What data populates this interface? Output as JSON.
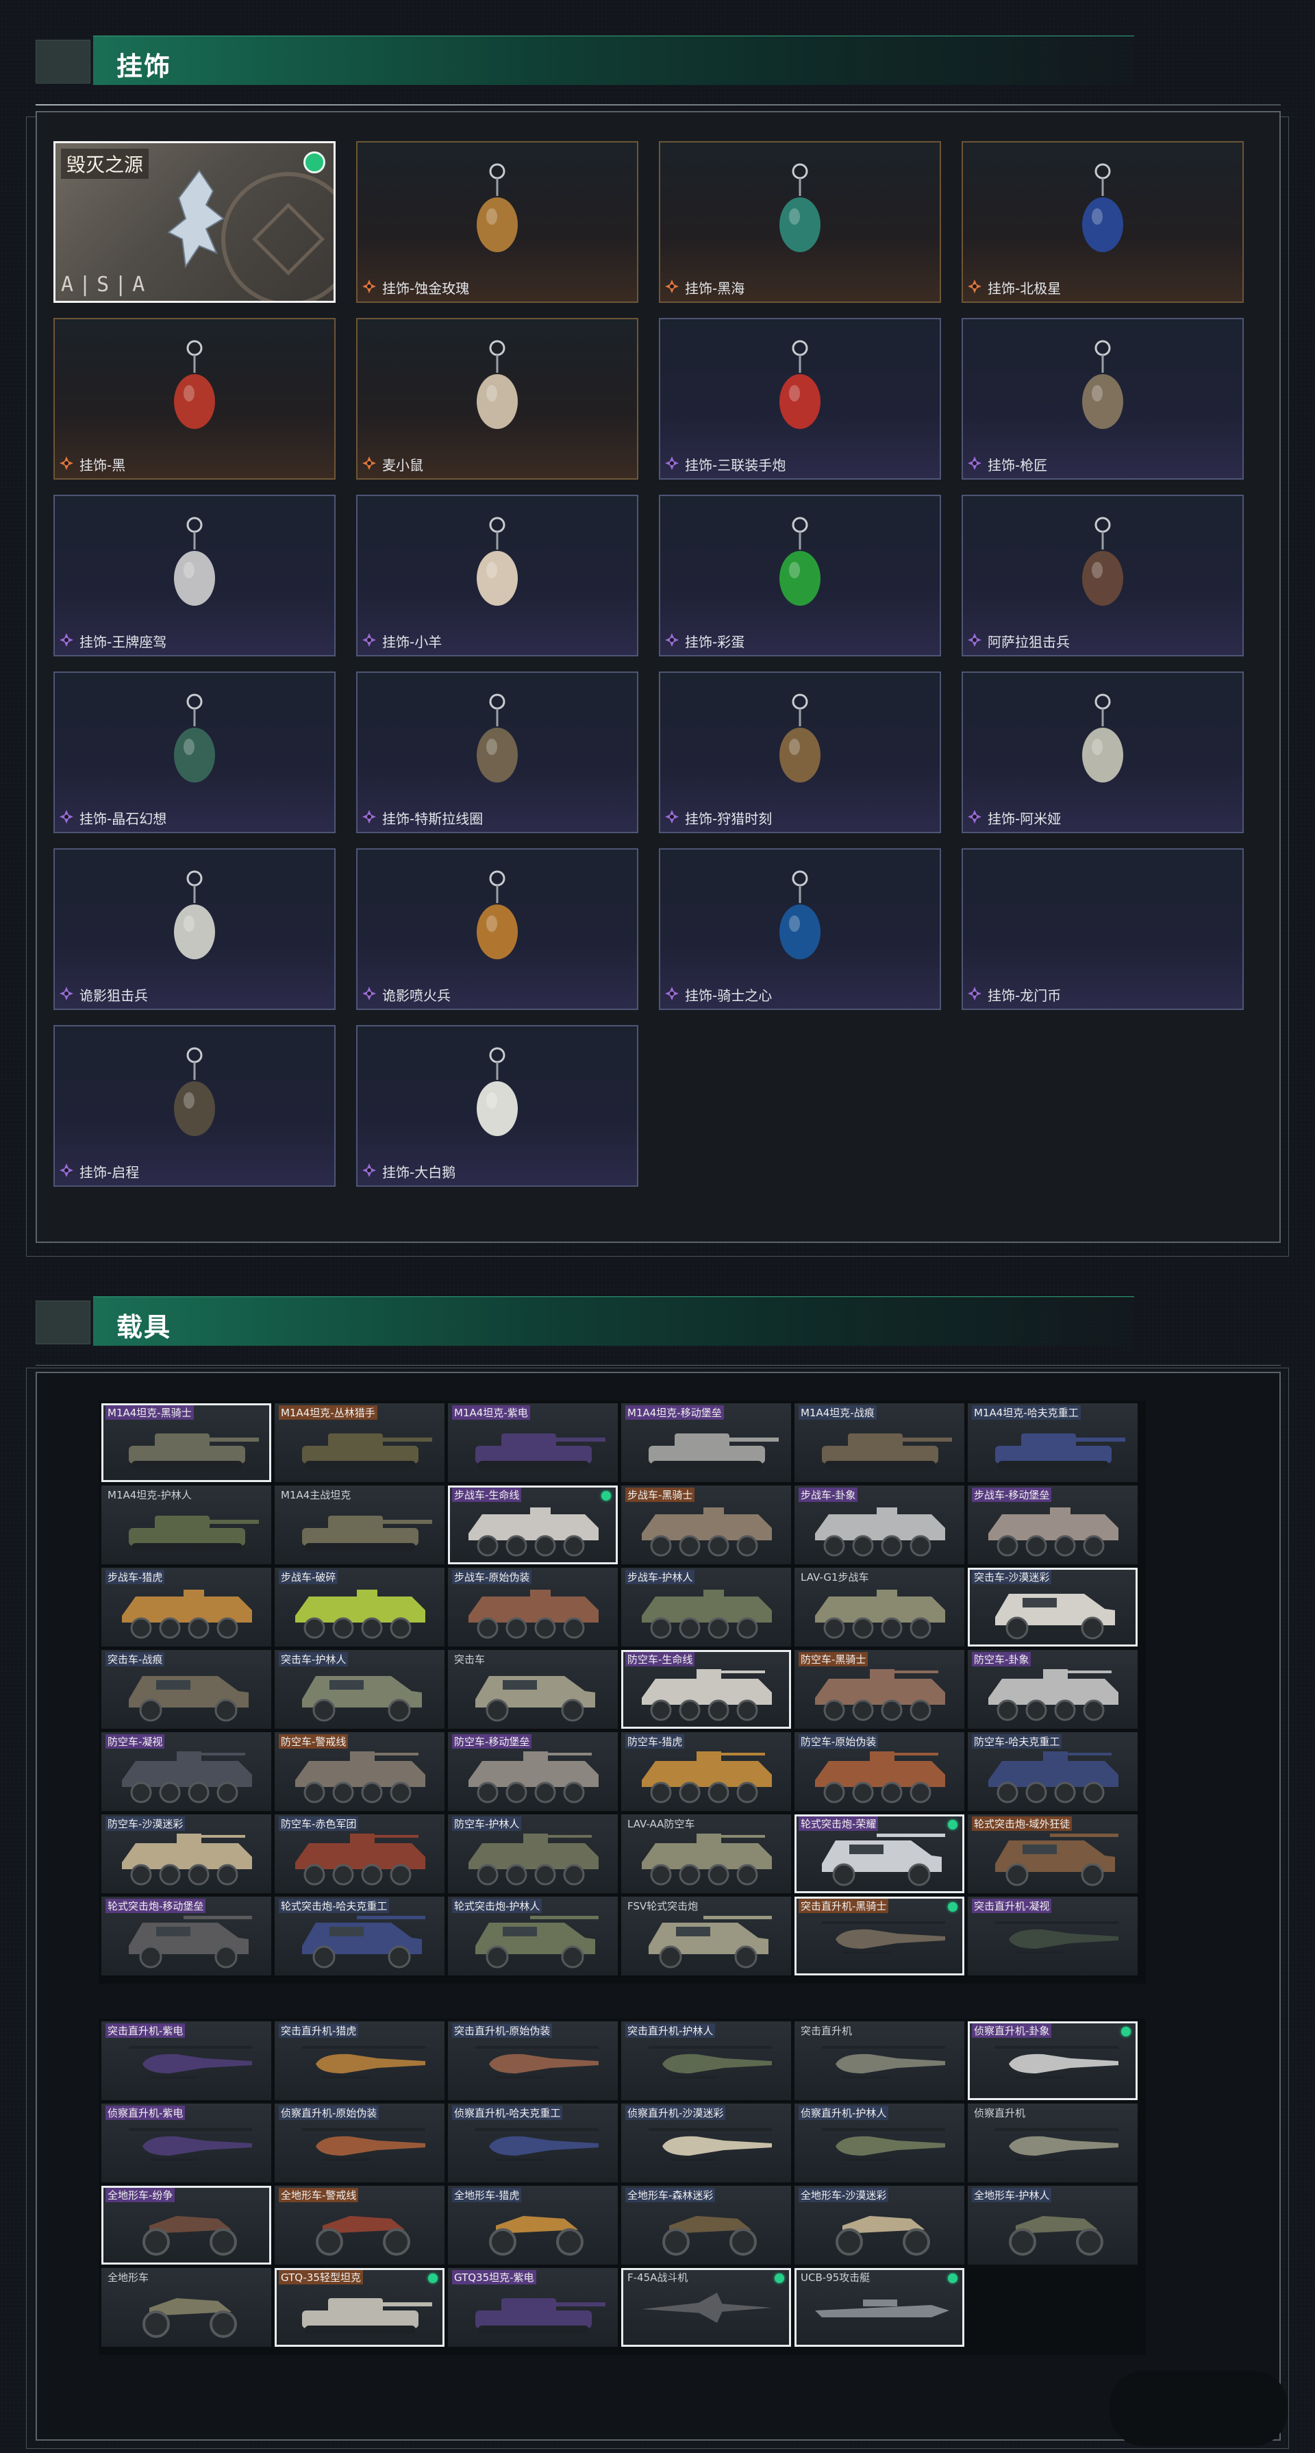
{
  "charms_section": {
    "title": "挂饰",
    "featured": {
      "title": "毁灭之源",
      "logo": "A|S|A"
    },
    "items": [
      {
        "name": "挂饰-蚀金玫瑰",
        "rarity": "orange"
      },
      {
        "name": "挂饰-黑海",
        "rarity": "orange"
      },
      {
        "name": "挂饰-北极星",
        "rarity": "orange"
      },
      {
        "name": "挂饰-黑",
        "rarity": "orange"
      },
      {
        "name": "麦小鼠",
        "rarity": "orange"
      },
      {
        "name": "挂饰-三联装手炮",
        "rarity": "purple"
      },
      {
        "name": "挂饰-枪匠",
        "rarity": "purple"
      },
      {
        "name": "挂饰-王牌座驾",
        "rarity": "purple"
      },
      {
        "name": "挂饰-小羊",
        "rarity": "purple"
      },
      {
        "name": "挂饰-彩蛋",
        "rarity": "purple"
      },
      {
        "name": "阿萨拉狙击兵",
        "rarity": "purple"
      },
      {
        "name": "挂饰-晶石幻想",
        "rarity": "purple"
      },
      {
        "name": "挂饰-特斯拉线圈",
        "rarity": "purple"
      },
      {
        "name": "挂饰-狩猎时刻",
        "rarity": "purple"
      },
      {
        "name": "挂饰-阿米娅",
        "rarity": "purple"
      },
      {
        "name": "诡影狙击兵",
        "rarity": "purple"
      },
      {
        "name": "诡影喷火兵",
        "rarity": "purple"
      },
      {
        "name": "挂饰-骑士之心",
        "rarity": "purple"
      },
      {
        "name": "挂饰-龙门币",
        "rarity": "purple"
      },
      {
        "name": "挂饰-启程",
        "rarity": "purple"
      },
      {
        "name": "挂饰-大白鹅",
        "rarity": "purple"
      }
    ]
  },
  "vehicles_section": {
    "title": "载具",
    "grid_a": [
      {
        "name": "M1A4坦克-黑骑士",
        "tag": "purple",
        "sel": true,
        "dot": false,
        "kind": "tank",
        "color": "#6a6a5a"
      },
      {
        "name": "M1A4坦克-丛林猎手",
        "tag": "orange",
        "sel": false,
        "dot": false,
        "kind": "tank",
        "color": "#5d5a40"
      },
      {
        "name": "M1A4坦克-紫电",
        "tag": "purple",
        "sel": false,
        "dot": false,
        "kind": "tank",
        "color": "#4a3c70"
      },
      {
        "name": "M1A4坦克-移动堡垒",
        "tag": "purple",
        "sel": false,
        "dot": false,
        "kind": "tank",
        "color": "#9a9b98"
      },
      {
        "name": "M1A4坦克-战痕",
        "tag": "blue",
        "sel": false,
        "dot": false,
        "kind": "tank",
        "color": "#6b5f4e"
      },
      {
        "name": "M1A4坦克-哈夫克重工",
        "tag": "blue",
        "sel": false,
        "dot": false,
        "kind": "tank",
        "color": "#3c4a80"
      },
      {
        "name": "M1A4坦克-护林人",
        "tag": "none",
        "sel": false,
        "dot": false,
        "kind": "tank",
        "color": "#5a6548"
      },
      {
        "name": "M1A4主战坦克",
        "tag": "none",
        "sel": false,
        "dot": false,
        "kind": "tank",
        "color": "#6d6a55"
      },
      {
        "name": "步战车-生命线",
        "tag": "purple",
        "sel": true,
        "dot": true,
        "kind": "apc",
        "color": "#c8c5c0"
      },
      {
        "name": "步战车-黑骑士",
        "tag": "orange",
        "sel": false,
        "dot": false,
        "kind": "apc",
        "color": "#8a7a6a"
      },
      {
        "name": "步战车-卦象",
        "tag": "purple",
        "sel": false,
        "dot": false,
        "kind": "apc",
        "color": "#b5b6b8"
      },
      {
        "name": "步战车-移动堡垒",
        "tag": "purple",
        "sel": false,
        "dot": false,
        "kind": "apc",
        "color": "#9a8f88"
      },
      {
        "name": "步战车-猎虎",
        "tag": "blue",
        "sel": false,
        "dot": false,
        "kind": "apc",
        "color": "#b5823d"
      },
      {
        "name": "步战车-破碎",
        "tag": "blue",
        "sel": false,
        "dot": false,
        "kind": "apc",
        "color": "#a8c040"
      },
      {
        "name": "步战车-原始伪装",
        "tag": "blue",
        "sel": false,
        "dot": false,
        "kind": "apc",
        "color": "#8a5c48"
      },
      {
        "name": "步战车-护林人",
        "tag": "blue",
        "sel": false,
        "dot": false,
        "kind": "apc",
        "color": "#6a7258"
      },
      {
        "name": "LAV-G1步战车",
        "tag": "none",
        "sel": false,
        "dot": false,
        "kind": "apc",
        "color": "#8a8a70"
      },
      {
        "name": "突击车-沙漠迷彩",
        "tag": "blue",
        "sel": true,
        "dot": false,
        "kind": "jeep",
        "color": "#d2d0c8"
      },
      {
        "name": "突击车-战痕",
        "tag": "blue",
        "sel": false,
        "dot": false,
        "kind": "jeep",
        "color": "#6e6656"
      },
      {
        "name": "突击车-护林人",
        "tag": "blue",
        "sel": false,
        "dot": false,
        "kind": "jeep",
        "color": "#7a806a"
      },
      {
        "name": "突击车",
        "tag": "none",
        "sel": false,
        "dot": false,
        "kind": "jeep",
        "color": "#9a9884"
      },
      {
        "name": "防空车-生命线",
        "tag": "purple",
        "sel": true,
        "dot": false,
        "kind": "aa",
        "color": "#c9c6c0"
      },
      {
        "name": "防空车-黑骑士",
        "tag": "orange",
        "sel": false,
        "dot": false,
        "kind": "aa",
        "color": "#8c6a5a"
      },
      {
        "name": "防空车-卦象",
        "tag": "purple",
        "sel": false,
        "dot": false,
        "kind": "aa",
        "color": "#b8b8b8"
      },
      {
        "name": "防空车-凝视",
        "tag": "purple",
        "sel": false,
        "dot": false,
        "kind": "aa",
        "color": "#4a4f5a"
      },
      {
        "name": "防空车-警戒线",
        "tag": "orange",
        "sel": false,
        "dot": false,
        "kind": "aa",
        "color": "#7a7268"
      },
      {
        "name": "防空车-移动堡垒",
        "tag": "purple",
        "sel": false,
        "dot": false,
        "kind": "aa",
        "color": "#8c8680"
      },
      {
        "name": "防空车-猎虎",
        "tag": "blue",
        "sel": false,
        "dot": false,
        "kind": "aa",
        "color": "#b6843a"
      },
      {
        "name": "防空车-原始伪装",
        "tag": "blue",
        "sel": false,
        "dot": false,
        "kind": "aa",
        "color": "#9a5a3a"
      },
      {
        "name": "防空车-哈夫克重工",
        "tag": "blue",
        "sel": false,
        "dot": false,
        "kind": "aa",
        "color": "#3a4878"
      },
      {
        "name": "防空车-沙漠迷彩",
        "tag": "blue",
        "sel": false,
        "dot": false,
        "kind": "aa",
        "color": "#b7a88a"
      },
      {
        "name": "防空车-赤色军团",
        "tag": "blue",
        "sel": false,
        "dot": false,
        "kind": "aa",
        "color": "#8a4030"
      },
      {
        "name": "防空车-护林人",
        "tag": "blue",
        "sel": false,
        "dot": false,
        "kind": "aa",
        "color": "#6a6e58"
      },
      {
        "name": "LAV-AA防空车",
        "tag": "none",
        "sel": false,
        "dot": false,
        "kind": "aa",
        "color": "#8a8a72"
      },
      {
        "name": "轮式突击炮-荣耀",
        "tag": "purple",
        "sel": true,
        "dot": true,
        "kind": "wheeled",
        "color": "#c9ccd0"
      },
      {
        "name": "轮式突击炮-域外狂徒",
        "tag": "orange",
        "sel": false,
        "dot": false,
        "kind": "wheeled",
        "color": "#7a5a40"
      },
      {
        "name": "轮式突击炮-移动堡垒",
        "tag": "purple",
        "sel": false,
        "dot": false,
        "kind": "wheeled",
        "color": "#5a5a5c"
      },
      {
        "name": "轮式突击炮-哈夫克重工",
        "tag": "blue",
        "sel": false,
        "dot": false,
        "kind": "wheeled",
        "color": "#3c4a80"
      },
      {
        "name": "轮式突击炮-护林人",
        "tag": "blue",
        "sel": false,
        "dot": false,
        "kind": "wheeled",
        "color": "#6a7258"
      },
      {
        "name": "FSV轮式突击炮",
        "tag": "none",
        "sel": false,
        "dot": false,
        "kind": "wheeled",
        "color": "#9a9882"
      },
      {
        "name": "突击直升机-黑骑士",
        "tag": "orange",
        "sel": true,
        "dot": true,
        "kind": "heli",
        "color": "#6e6458"
      },
      {
        "name": "突击直升机-凝视",
        "tag": "purple",
        "sel": false,
        "dot": false,
        "kind": "heli",
        "color": "#3e4a40"
      }
    ],
    "grid_b": [
      {
        "name": "突击直升机-紫电",
        "tag": "purple",
        "sel": false,
        "dot": false,
        "kind": "heli",
        "color": "#4a3c70"
      },
      {
        "name": "突击直升机-猎虎",
        "tag": "blue",
        "sel": false,
        "dot": false,
        "kind": "heli",
        "color": "#a8783a"
      },
      {
        "name": "突击直升机-原始伪装",
        "tag": "blue",
        "sel": false,
        "dot": false,
        "kind": "heli",
        "color": "#8a5c48"
      },
      {
        "name": "突击直升机-护林人",
        "tag": "blue",
        "sel": false,
        "dot": false,
        "kind": "heli",
        "color": "#5e6a50"
      },
      {
        "name": "突击直升机",
        "tag": "none",
        "sel": false,
        "dot": false,
        "kind": "heli",
        "color": "#7a7c70"
      },
      {
        "name": "侦察直升机-卦象",
        "tag": "purple",
        "sel": true,
        "dot": true,
        "kind": "scout",
        "color": "#c0c0c0"
      },
      {
        "name": "侦察直升机-紫电",
        "tag": "purple",
        "sel": false,
        "dot": false,
        "kind": "scout",
        "color": "#4a3c70"
      },
      {
        "name": "侦察直升机-原始伪装",
        "tag": "blue",
        "sel": false,
        "dot": false,
        "kind": "scout",
        "color": "#9a5a3a"
      },
      {
        "name": "侦察直升机-哈夫克重工",
        "tag": "blue",
        "sel": false,
        "dot": false,
        "kind": "scout",
        "color": "#3c4a80"
      },
      {
        "name": "侦察直升机-沙漠迷彩",
        "tag": "blue",
        "sel": false,
        "dot": false,
        "kind": "scout",
        "color": "#c8bfa8"
      },
      {
        "name": "侦察直升机-护林人",
        "tag": "blue",
        "sel": false,
        "dot": false,
        "kind": "scout",
        "color": "#6a7258"
      },
      {
        "name": "侦察直升机",
        "tag": "none",
        "sel": false,
        "dot": false,
        "kind": "scout",
        "color": "#8a8a7a"
      },
      {
        "name": "全地形车-纷争",
        "tag": "purple",
        "sel": true,
        "dot": false,
        "kind": "atv",
        "color": "#6a4a3c"
      },
      {
        "name": "全地形车-警戒线",
        "tag": "orange",
        "sel": false,
        "dot": false,
        "kind": "atv",
        "color": "#8a4030"
      },
      {
        "name": "全地形车-猎虎",
        "tag": "blue",
        "sel": false,
        "dot": false,
        "kind": "atv",
        "color": "#b8843a"
      },
      {
        "name": "全地形车-森林迷彩",
        "tag": "blue",
        "sel": false,
        "dot": false,
        "kind": "atv",
        "color": "#6a5a40"
      },
      {
        "name": "全地形车-沙漠迷彩",
        "tag": "blue",
        "sel": false,
        "dot": false,
        "kind": "atv",
        "color": "#b7a88a"
      },
      {
        "name": "全地形车-护林人",
        "tag": "blue",
        "sel": false,
        "dot": false,
        "kind": "atv",
        "color": "#6a6e58"
      },
      {
        "name": "全地形车",
        "tag": "none",
        "sel": false,
        "dot": false,
        "kind": "atv",
        "color": "#7a7860"
      },
      {
        "name": "GTQ-35轻型坦克",
        "tag": "orange",
        "sel": true,
        "dot": true,
        "kind": "tank",
        "color": "#b9b7ae"
      },
      {
        "name": "GTQ35坦克-紫电",
        "tag": "purple",
        "sel": false,
        "dot": false,
        "kind": "tank",
        "color": "#4a3c70"
      },
      {
        "name": "F-45A战斗机",
        "tag": "none",
        "sel": true,
        "dot": true,
        "kind": "jet",
        "color": "#5a5c60"
      },
      {
        "name": "UCB-95攻击艇",
        "tag": "none",
        "sel": true,
        "dot": true,
        "kind": "boat",
        "color": "#80868c"
      }
    ]
  }
}
